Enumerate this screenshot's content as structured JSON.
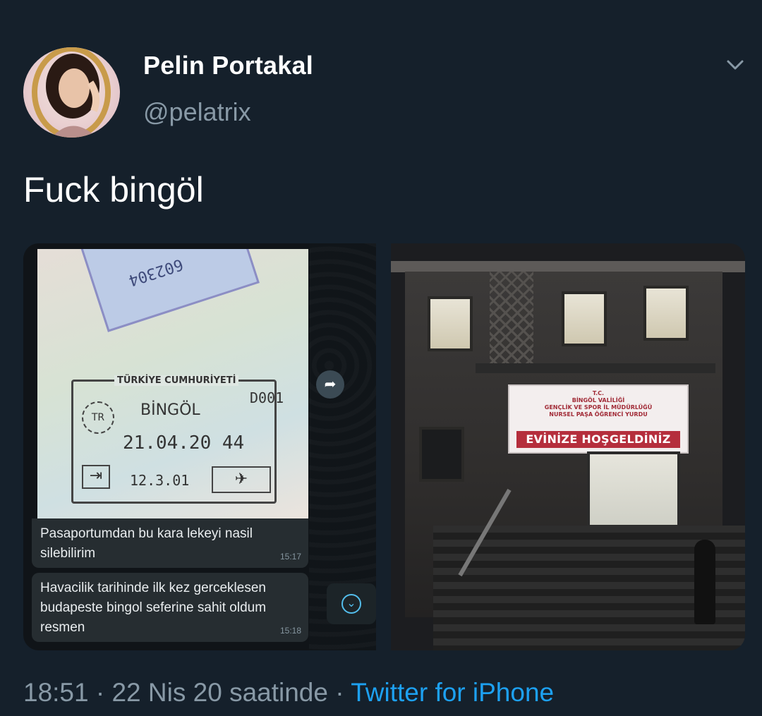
{
  "user": {
    "name": "Pelin Portakal",
    "handle": "@pelatrix"
  },
  "tweet": {
    "text": "Fuck bingöl"
  },
  "media_left": {
    "stamp": {
      "title": "TÜRKİYE CUMHURİYETİ",
      "city": "BİNGÖL",
      "date": "21.04.20",
      "number": "44",
      "code": "D001",
      "tr": "TR",
      "date2": "12.3.01",
      "top_number": "602304"
    },
    "messages": [
      {
        "text": "Pasaportumdan bu kara lekeyi nasil silebilirim",
        "time": "15:17"
      },
      {
        "text": "Havacilik tarihinde ilk kez gerceklesen budapeste bingol seferine sahit oldum resmen",
        "time": "15:18"
      }
    ]
  },
  "media_right": {
    "banner": {
      "lines": [
        "T.C.",
        "BİNGÖL VALİLİĞİ",
        "GENÇLİK VE SPOR İL MÜDÜRLÜĞÜ",
        "NURSEL PAŞA ÖĞRENCİ YURDU"
      ],
      "main": "EVİNİZE HOŞGELDİNİZ"
    }
  },
  "footer": {
    "time": "18:51",
    "date": "22 Nis 20 saatinde",
    "separator": "·",
    "source": "Twitter for iPhone"
  },
  "colors": {
    "background": "#15202b",
    "muted": "#8899a6",
    "link": "#1da1f2"
  }
}
